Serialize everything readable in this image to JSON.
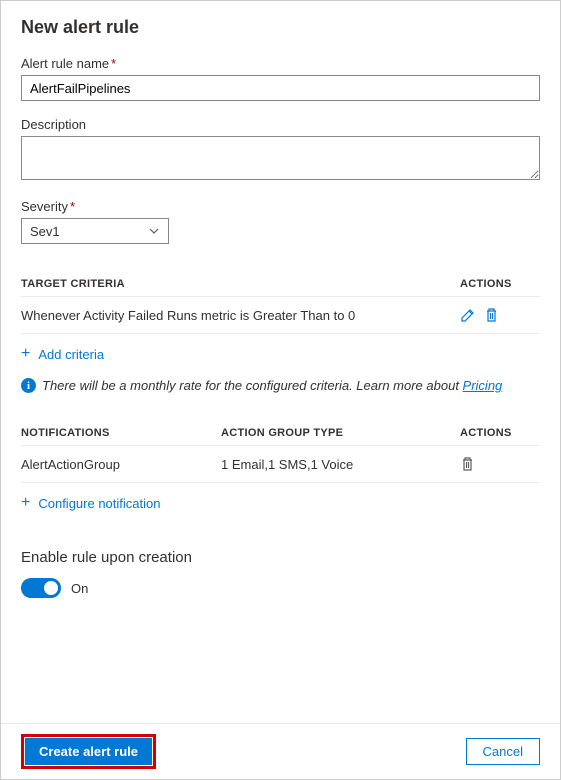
{
  "title": "New alert rule",
  "fields": {
    "name_label": "Alert rule name",
    "name_value": "AlertFailPipelines",
    "description_label": "Description",
    "description_value": "",
    "severity_label": "Severity",
    "severity_value": "Sev1"
  },
  "criteria": {
    "header_target": "TARGET CRITERIA",
    "header_actions": "ACTIONS",
    "rows": [
      {
        "text": "Whenever Activity Failed Runs metric is Greater Than to 0"
      }
    ],
    "add_label": "Add criteria",
    "info_text": "There will be a monthly rate for the configured criteria. Learn more about ",
    "pricing_link": "Pricing"
  },
  "notifications": {
    "header_notif": "NOTIFICATIONS",
    "header_agtype": "ACTION GROUP TYPE",
    "header_actions": "ACTIONS",
    "rows": [
      {
        "name": "AlertActionGroup",
        "type": "1 Email,1 SMS,1 Voice"
      }
    ],
    "configure_label": "Configure notification"
  },
  "enable": {
    "label": "Enable rule upon creation",
    "state_text": "On"
  },
  "footer": {
    "create": "Create alert rule",
    "cancel": "Cancel"
  }
}
